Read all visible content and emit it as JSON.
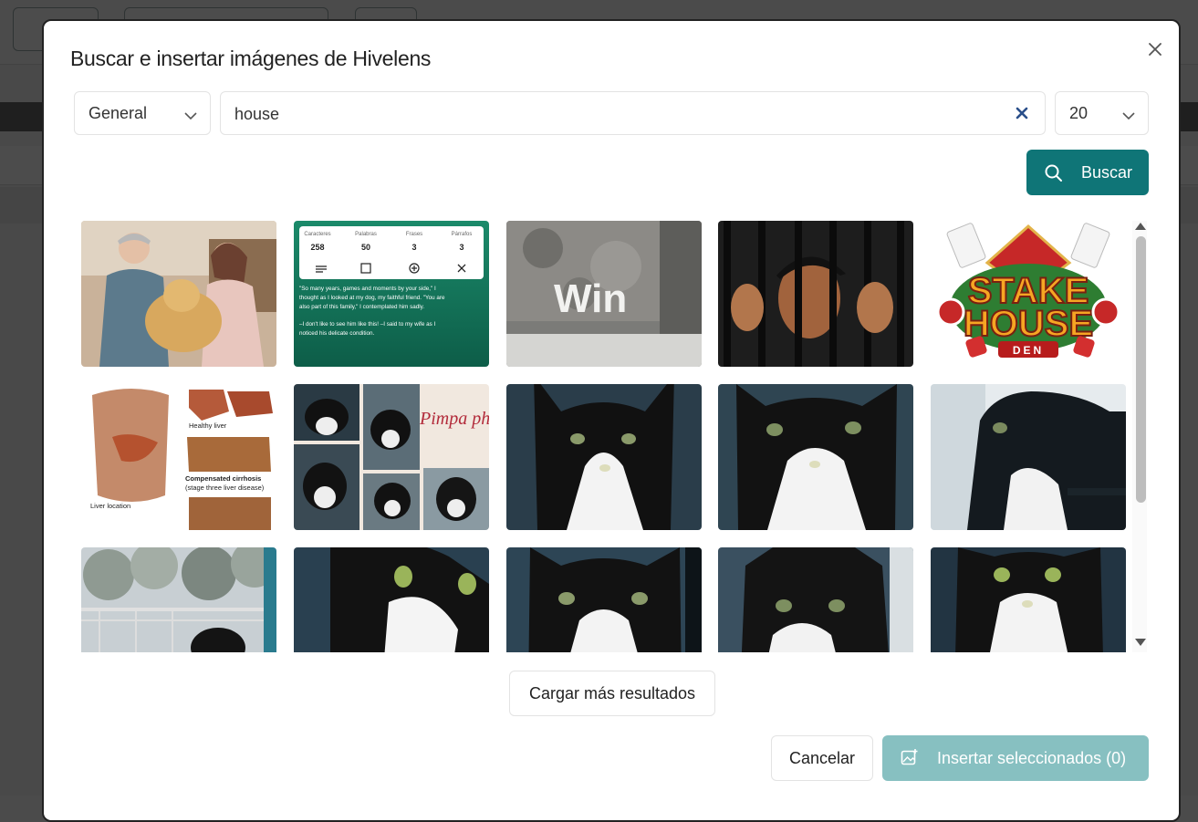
{
  "dialog": {
    "title": "Buscar e insertar imágenes de Hivelens",
    "category_select": {
      "value": "General"
    },
    "search": {
      "value": "house"
    },
    "count_select": {
      "value": "20"
    },
    "search_button_label": "Buscar",
    "load_more_label": "Cargar más resultados",
    "cancel_label": "Cancelar",
    "insert_label": "Insertar seleccionados (0)"
  },
  "thumbnails": [
    {
      "subject": "man and woman petting a golden retriever"
    },
    {
      "subject": "text editor screenshot with word counts",
      "stats_labels": [
        "Caracteres",
        "Palabras",
        "Frases",
        "Párrafos"
      ],
      "stats_values": [
        "258",
        "50",
        "3",
        "3"
      ],
      "text_lines": [
        "\"So many years, games and moments by your side,\" I",
        "thought as I looked at my dog, my faithful friend. \"You are",
        "also part of this family,\" I contemplated him sadly.",
        "",
        "–I don't like to see him like this! –I said to my wife as I",
        "noticed his delicate condition."
      ]
    },
    {
      "subject": "word Win in glass letters on concrete",
      "word": "Win"
    },
    {
      "subject": "person behind bars"
    },
    {
      "subject": "Stake House Den logo",
      "line1": "STAKE",
      "line2": "HOUSE",
      "line3": "DEN"
    },
    {
      "subject": "liver diagram",
      "labels": [
        "Healthy liver",
        "Compensated cirrhosis",
        "(stage three liver disease)",
        "Liver location"
      ]
    },
    {
      "subject": "black and white cat photo collage",
      "script": "Pimpa photoset"
    },
    {
      "subject": "black and white cat close-up"
    },
    {
      "subject": "black and white cat close-up"
    },
    {
      "subject": "black and white cat at window"
    },
    {
      "subject": "cat in garden"
    },
    {
      "subject": "black and white cat close-up"
    },
    {
      "subject": "black and white cat close-up"
    },
    {
      "subject": "black and white cat close-up"
    },
    {
      "subject": "black and white cat looking up"
    }
  ],
  "colors": {
    "accent": "#0f7577",
    "accent_disabled": "#87c0c1"
  }
}
